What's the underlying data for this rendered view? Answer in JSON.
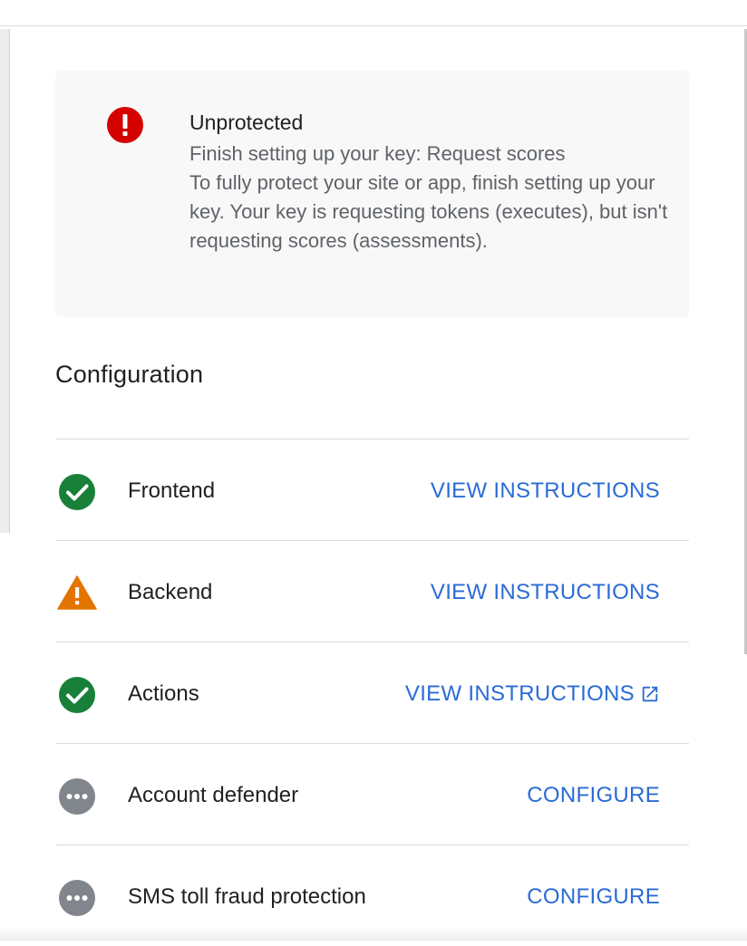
{
  "alert": {
    "icon": "error-icon",
    "color": "#d50000",
    "title": "Unprotected",
    "subtitle": "Finish setting up your key: Request scores",
    "body": "To fully protect your site or app, finish setting up your key. Your key is requesting tokens (executes), but isn't requesting scores (assessments)."
  },
  "configuration": {
    "title": "Configuration",
    "items": [
      {
        "label": "Frontend",
        "status": "complete",
        "status_icon": "check-circle-icon",
        "action": "VIEW INSTRUCTIONS",
        "external": false
      },
      {
        "label": "Backend",
        "status": "warning",
        "status_icon": "warning-icon",
        "action": "VIEW INSTRUCTIONS",
        "external": false
      },
      {
        "label": "Actions",
        "status": "complete",
        "status_icon": "check-circle-icon",
        "action": "VIEW INSTRUCTIONS",
        "external": true
      },
      {
        "label": "Account defender",
        "status": "not-configured",
        "status_icon": "more-horiz-icon",
        "action": "CONFIGURE",
        "external": false
      },
      {
        "label": "SMS toll fraud protection",
        "status": "not-configured",
        "status_icon": "more-horiz-icon",
        "action": "CONFIGURE",
        "external": false
      }
    ]
  },
  "colors": {
    "success": "#188038",
    "warning": "#e37400",
    "neutral": "#80868b",
    "link": "#2a6bd6",
    "error": "#d50000"
  }
}
